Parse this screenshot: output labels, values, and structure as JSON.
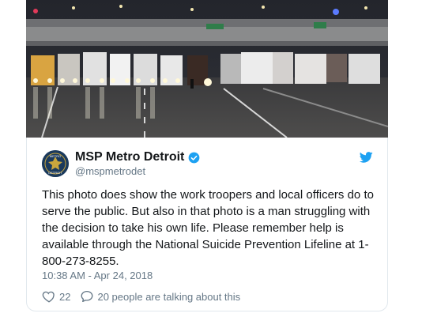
{
  "tweet": {
    "display_name": "MSP Metro Detroit",
    "handle": "@mspmetrodet",
    "avatar_text_top": "METRO",
    "avatar_text_bottom": "DETROIT",
    "body": "This photo does show the work troopers and local officers do to\nserve the public. But also in that photo is a man struggling with\nthe decision to take his own life. Please remember help is\navailable through the National Suicide Prevention Lifeline at 1-\n800-273-8255.",
    "timestamp": "10:38 AM - Apr 24, 2018",
    "likes": "22",
    "replies_text": "20 people are talking about this"
  },
  "icons": {
    "verified": "verified-badge-icon",
    "twitter": "twitter-bird-icon",
    "like": "heart-icon",
    "reply": "speech-bubble-icon"
  },
  "colors": {
    "twitter_blue": "#1da1f2",
    "text": "#14171a",
    "muted": "#657786",
    "border": "#e1e8ed"
  }
}
